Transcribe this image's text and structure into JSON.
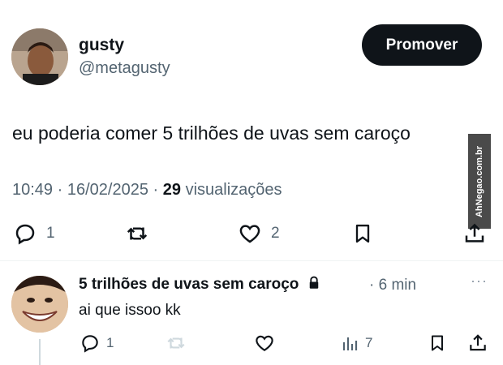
{
  "post": {
    "author_name": "gusty",
    "author_handle": "@metagusty",
    "promote_label": "Promover",
    "text": "eu poderia comer 5 trilhões de uvas sem caroço",
    "time": "10:49",
    "date": "16/02/2025",
    "views_count": "29",
    "views_label": "visualizações",
    "separator": "·",
    "replies": "1",
    "likes": "2"
  },
  "watermark": {
    "text": "AhNegao.com.br"
  },
  "reply": {
    "author_name": "5 trilhões de uvas sem caroço",
    "time": "6 min",
    "separator": "·",
    "more": "···",
    "text": "ai que issoo kk",
    "replies": "1",
    "views": "7"
  },
  "colors": {
    "text": "#0f1419",
    "muted": "#536471",
    "button": "#0f1419"
  }
}
